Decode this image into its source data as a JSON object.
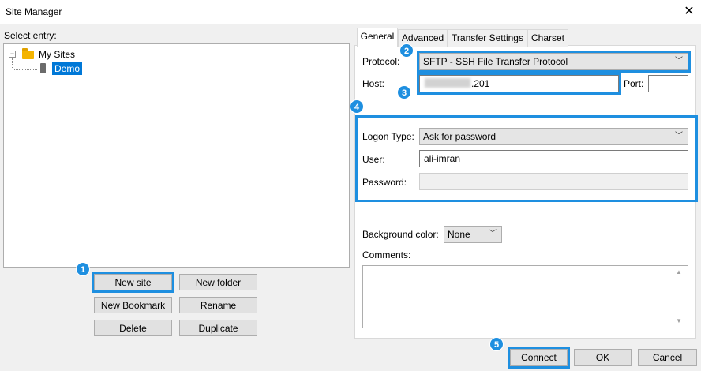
{
  "window": {
    "title": "Site Manager",
    "close_glyph": "✕"
  },
  "left": {
    "select_entry_label": "Select entry:",
    "tree": {
      "expander": "−",
      "root_label": "My Sites",
      "child_label": "Demo"
    },
    "buttons": {
      "new_site": "New site",
      "new_folder": "New folder",
      "new_bookmark": "New Bookmark",
      "rename": "Rename",
      "delete": "Delete",
      "duplicate": "Duplicate"
    }
  },
  "tabs": [
    "General",
    "Advanced",
    "Transfer Settings",
    "Charset"
  ],
  "general": {
    "protocol_label": "Protocol:",
    "protocol_value": "SFTP - SSH File Transfer Protocol",
    "host_label": "Host:",
    "host_value": ".201",
    "port_label": "Port:",
    "port_value": "",
    "logon_type_label": "Logon Type:",
    "logon_type_value": "Ask for password",
    "user_label": "User:",
    "user_value": "ali-imran",
    "password_label": "Password:",
    "password_value": "",
    "bg_color_label": "Background color:",
    "bg_color_value": "None",
    "comments_label": "Comments:",
    "comments_value": ""
  },
  "footer": {
    "connect": "Connect",
    "ok": "OK",
    "cancel": "Cancel"
  },
  "badges": [
    "1",
    "2",
    "3",
    "4",
    "5"
  ],
  "colors": {
    "highlight": "#1e8fe0",
    "selection": "#0078d7"
  }
}
